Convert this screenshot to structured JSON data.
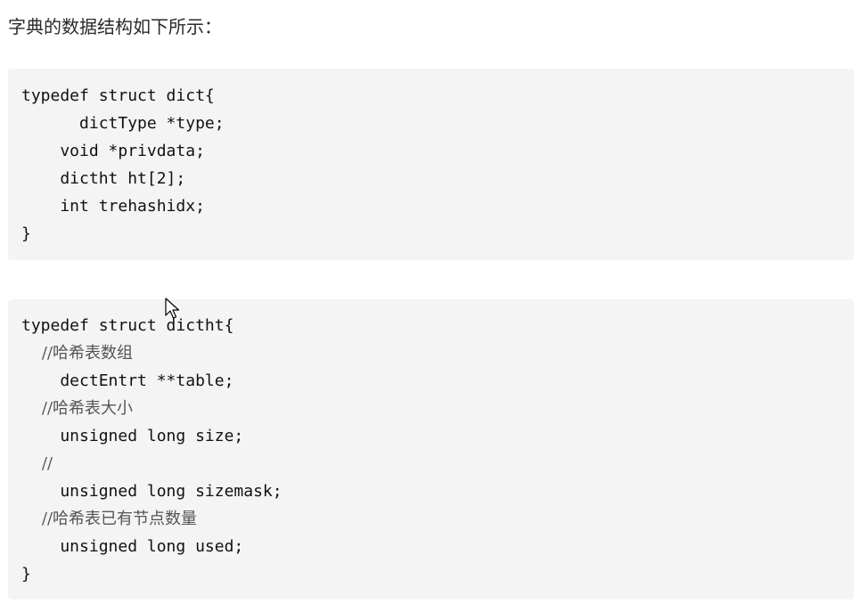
{
  "intro_text": "字典的数据结构如下所示：",
  "code_blocks": [
    {
      "lines": [
        "typedef struct dict{",
        "      dictType *type;",
        "    void *privdata;",
        "    dictht ht[2];",
        "    int trehashidx;",
        "}"
      ]
    },
    {
      "lines": [
        "typedef struct dictht{",
        "    //哈希表数组",
        "    dectEntrt **table;",
        "    //哈希表大小",
        "    unsigned long size;",
        "    //",
        "    unsigned long sizemask;",
        "    //哈希表已有节点数量",
        "    unsigned long used;",
        "}"
      ]
    }
  ],
  "colors": {
    "code_background": "#f4f4f4",
    "text": "#111111",
    "comment": "#555555"
  },
  "icons": {
    "cursor": "mouse-pointer-icon"
  }
}
